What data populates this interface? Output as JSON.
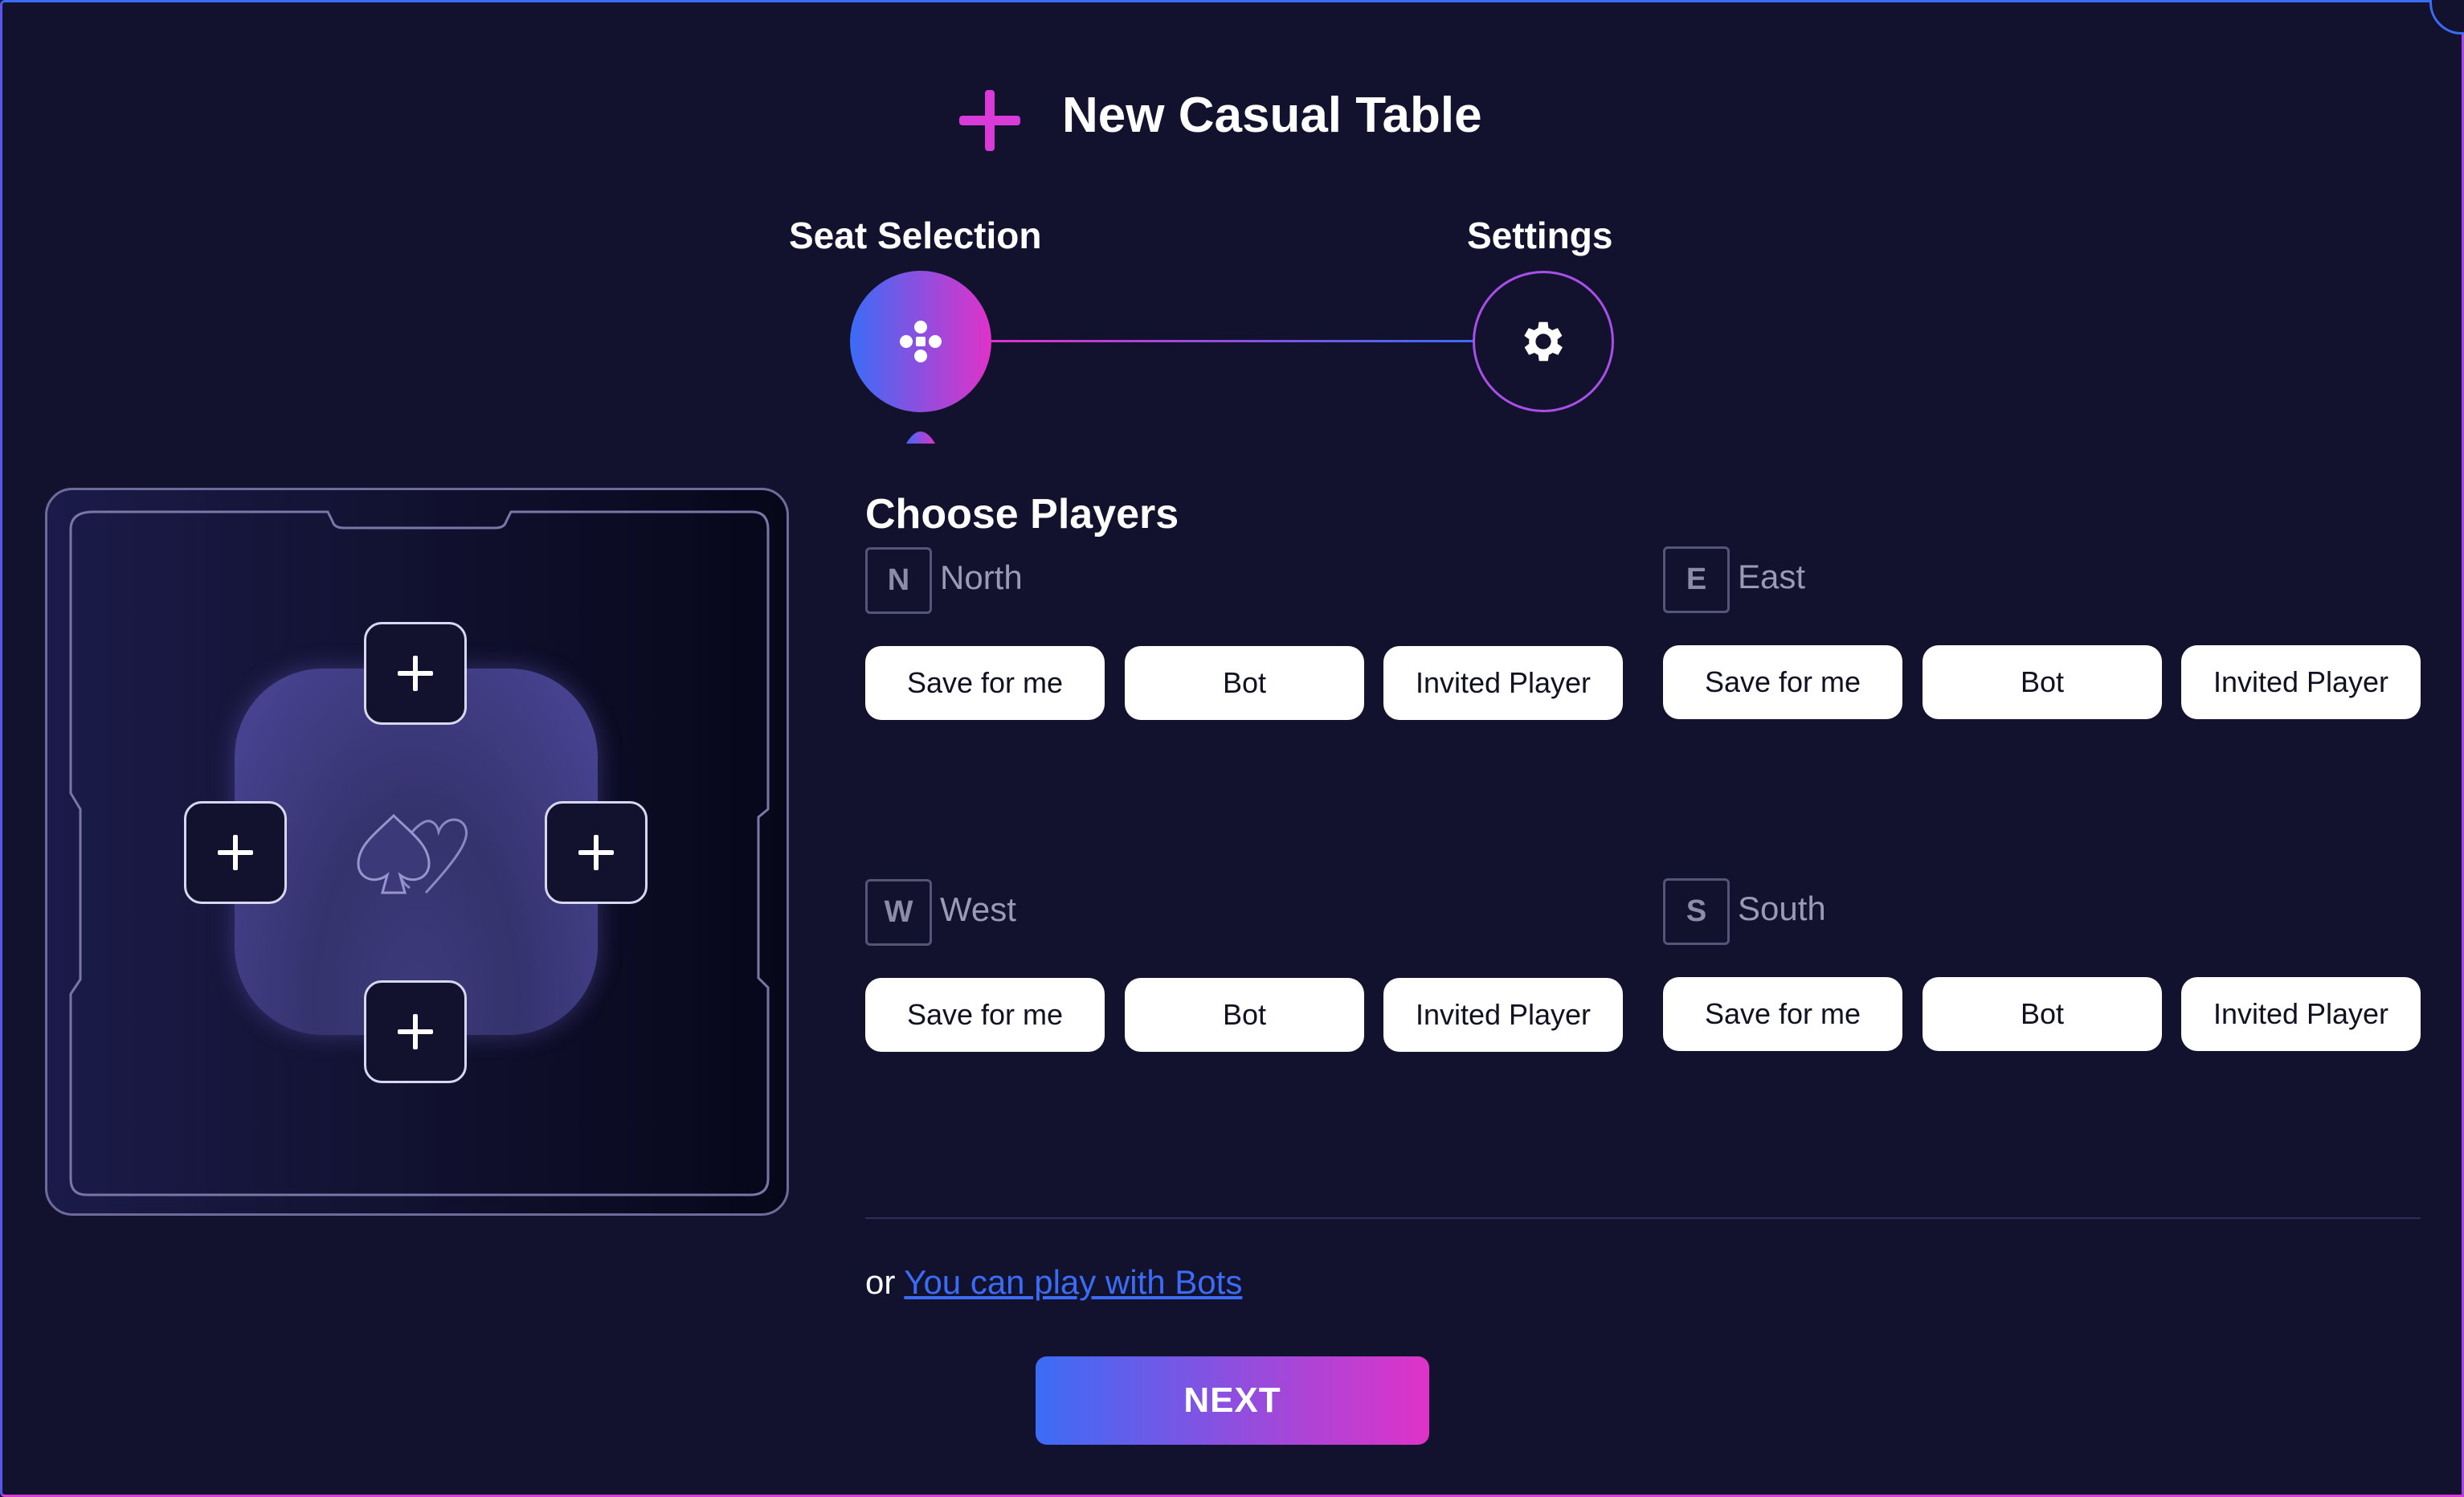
{
  "header": {
    "title": "New Casual Table",
    "accent_color": "#d93bd8"
  },
  "stepper": {
    "steps": [
      {
        "label": "Seat Selection",
        "icon": "seat-grid-icon",
        "state": "active"
      },
      {
        "label": "Settings",
        "icon": "gear-icon",
        "state": "inactive"
      }
    ],
    "gradient_start": "#3b6cf6",
    "gradient_end": "#e032c8"
  },
  "table_preview": {
    "center_icon": "spade-heart-icon",
    "seat_slot_icon": "plus-icon"
  },
  "choose_players": {
    "title": "Choose Players",
    "seats": {
      "north": {
        "badge": "N",
        "name": "North"
      },
      "east": {
        "badge": "E",
        "name": "East"
      },
      "west": {
        "badge": "W",
        "name": "West"
      },
      "south": {
        "badge": "S",
        "name": "South"
      }
    },
    "options": {
      "save": "Save for me",
      "bot": "Bot",
      "invited": "Invited Player"
    }
  },
  "footer": {
    "or_text": "or",
    "bots_link": "You can play with Bots",
    "next_label": "NEXT",
    "link_color": "#3b6cf6"
  }
}
